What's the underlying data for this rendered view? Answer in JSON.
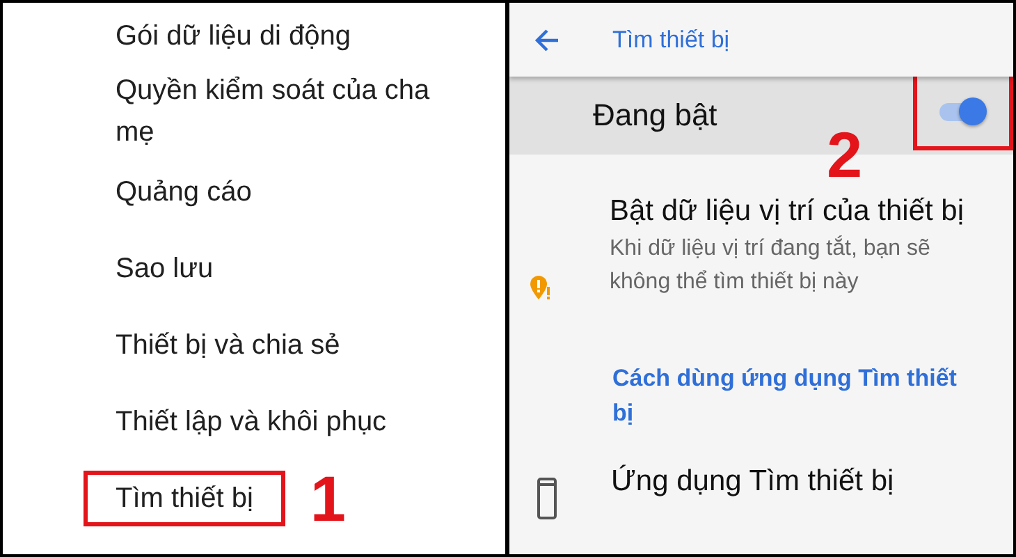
{
  "settings_menu": {
    "items": [
      {
        "label": "Gói dữ liệu di động",
        "highlighted": false
      },
      {
        "label": "Quyền kiểm soát của cha mẹ",
        "highlighted": false
      },
      {
        "label": "Quảng cáo",
        "highlighted": false
      },
      {
        "label": "Sao lưu",
        "highlighted": false
      },
      {
        "label": "Thiết bị và chia sẻ",
        "highlighted": false
      },
      {
        "label": "Thiết lập và khôi phục",
        "highlighted": false
      },
      {
        "label": "Tìm thiết bị",
        "highlighted": true,
        "step": "1"
      }
    ]
  },
  "find_device": {
    "title": "Tìm thiết bị",
    "master_switch": {
      "label": "Đang bật",
      "on": true,
      "highlighted": true,
      "step": "2"
    },
    "location_item": {
      "title": "Bật dữ liệu vị trí của thiết bị",
      "subtitle": "Khi dữ liệu vị trí đang tắt, bạn sẽ không thể tìm thiết bị này"
    },
    "help_link": "Cách dùng ứng dụng Tìm thiết bị",
    "app_item": {
      "title": "Ứng dụng Tìm thiết bị"
    }
  }
}
